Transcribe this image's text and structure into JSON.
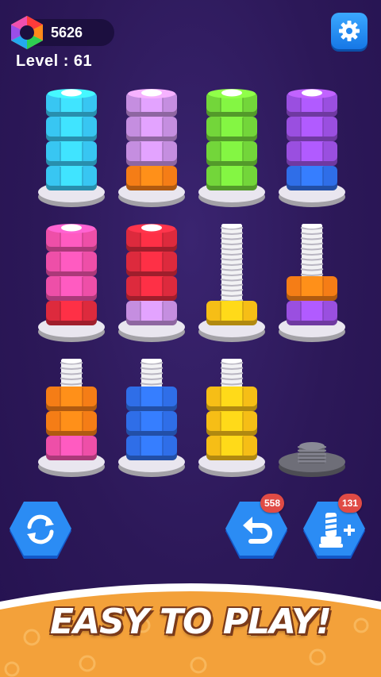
{
  "header": {
    "coins": "5626",
    "coin_icon": "rainbow-hex-nut-icon",
    "level_text": "Level : 61",
    "settings_icon": "gear-icon"
  },
  "colors": {
    "cyan": "#38c6f2",
    "lilac": "#c58ee0",
    "green": "#73d63a",
    "purple": "#9a4fe0",
    "pink": "#ee4fa8",
    "red": "#dd2a3d",
    "orange": "#f57d16",
    "blue": "#2f6ee8",
    "yellow": "#f6be16",
    "gray": "#6e6e78"
  },
  "bolts": [
    {
      "nuts": [
        "cyan",
        "cyan",
        "cyan",
        "cyan"
      ],
      "complete": true
    },
    {
      "nuts": [
        "orange",
        "lilac",
        "lilac",
        "lilac"
      ],
      "complete": false
    },
    {
      "nuts": [
        "green",
        "green",
        "green",
        "green"
      ],
      "complete": true
    },
    {
      "nuts": [
        "blue",
        "purple",
        "purple",
        "purple"
      ],
      "complete": false
    },
    {
      "nuts": [
        "red",
        "pink",
        "pink",
        "pink"
      ],
      "complete": false
    },
    {
      "nuts": [
        "lilac",
        "red",
        "red",
        "red"
      ],
      "complete": false
    },
    {
      "nuts": [
        "yellow"
      ],
      "complete": false
    },
    {
      "nuts": [
        "purple",
        "orange"
      ],
      "complete": false
    },
    {
      "nuts": [
        "pink",
        "orange",
        "orange"
      ],
      "complete": false
    },
    {
      "nuts": [
        "blue",
        "blue",
        "blue"
      ],
      "complete": false
    },
    {
      "nuts": [
        "yellow",
        "yellow",
        "yellow"
      ],
      "complete": false
    },
    {
      "nuts": [],
      "complete": false,
      "locked": true
    }
  ],
  "controls": {
    "restart_icon": "restart-icon",
    "undo_icon": "undo-icon",
    "undo_count": "558",
    "add_bolt_icon": "add-bolt-icon",
    "add_bolt_count": "131"
  },
  "banner": {
    "text": "EASY TO PLAY!"
  }
}
